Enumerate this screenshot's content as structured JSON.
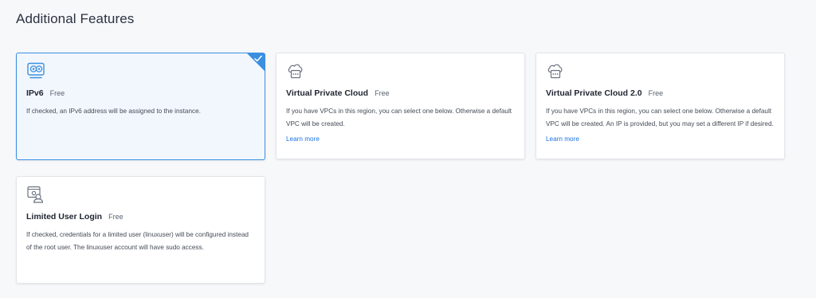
{
  "section": {
    "title": "Additional Features"
  },
  "features": [
    {
      "name": "IPv6",
      "price": "Free",
      "description": "If checked, an IPv6 address will be assigned to the instance.",
      "link": "",
      "selected": true,
      "icon": "ipv6-icon"
    },
    {
      "name": "Virtual Private Cloud",
      "price": "Free",
      "description": "If you have VPCs in this region, you can select one below. Otherwise a default VPC will be created.",
      "link": "Learn more",
      "selected": false,
      "icon": "cloud-network-icon"
    },
    {
      "name": "Virtual Private Cloud 2.0",
      "price": "Free",
      "description": "If you have VPCs in this region, you can select one below. Otherwise a default VPC will be created. An IP is provided, but you may set a different IP if desired.",
      "link": "Learn more",
      "selected": false,
      "icon": "cloud-network-icon"
    },
    {
      "name": "Limited User Login",
      "price": "Free",
      "description": "If checked, credentials for a limited user (linuxuser) will be configured instead of the root user. The linuxuser account will have sudo access.",
      "link": "",
      "selected": false,
      "icon": "user-window-icon"
    }
  ],
  "colors": {
    "accent": "#3a8fe0",
    "link": "#1a73e8",
    "selected_bg": "#f2f7fd"
  }
}
